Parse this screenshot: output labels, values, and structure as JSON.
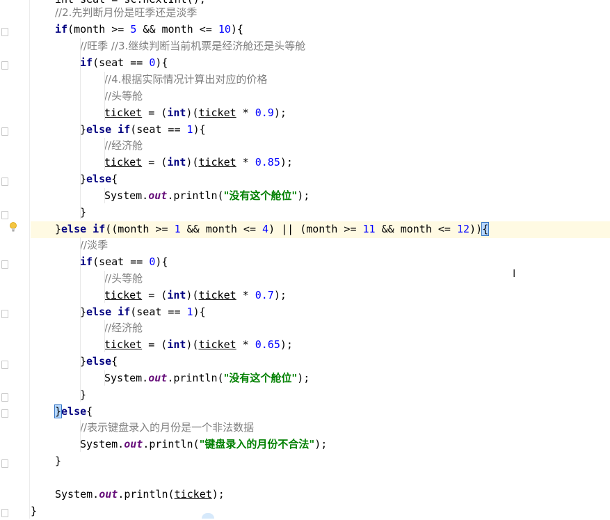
{
  "editor": {
    "lines": [
      {
        "id": "l0",
        "parts": [
          {
            "t": "int seat = sc.nextInt();",
            "k": "partial"
          }
        ]
      },
      {
        "id": "l1",
        "parts": [
          {
            "t": "//2.先判断月份是旺季还是淡季",
            "k": "comment"
          }
        ]
      },
      {
        "id": "l2",
        "parts": [
          {
            "t": "if",
            "k": "kw"
          },
          {
            "t": "(month >= ",
            "k": "var"
          },
          {
            "t": "5",
            "k": "num"
          },
          {
            "t": " && month <= ",
            "k": "var"
          },
          {
            "t": "10",
            "k": "num"
          },
          {
            "t": "){",
            "k": "var"
          }
        ]
      },
      {
        "id": "l3",
        "parts": [
          {
            "t": "//旺季 //3.继续判断当前机票是经济舱还是头等舱",
            "k": "comment"
          }
        ]
      },
      {
        "id": "l4",
        "parts": [
          {
            "t": "if",
            "k": "kw"
          },
          {
            "t": "(seat == ",
            "k": "var"
          },
          {
            "t": "0",
            "k": "num"
          },
          {
            "t": "){",
            "k": "var"
          }
        ]
      },
      {
        "id": "l5",
        "parts": [
          {
            "t": "//4.根据实际情况计算出对应的价格",
            "k": "comment"
          }
        ]
      },
      {
        "id": "l6",
        "parts": [
          {
            "t": "//头等舱",
            "k": "comment"
          }
        ]
      },
      {
        "id": "l7",
        "parts": [
          {
            "t": "ticket",
            "k": "ul"
          },
          {
            "t": " = (",
            "k": "var"
          },
          {
            "t": "int",
            "k": "kw"
          },
          {
            "t": ")(",
            "k": "var"
          },
          {
            "t": "ticket",
            "k": "ul"
          },
          {
            "t": " * ",
            "k": "var"
          },
          {
            "t": "0.9",
            "k": "num"
          },
          {
            "t": ");",
            "k": "var"
          }
        ]
      },
      {
        "id": "l8",
        "parts": [
          {
            "t": "}",
            "k": "var"
          },
          {
            "t": "else if",
            "k": "kw"
          },
          {
            "t": "(seat == ",
            "k": "var"
          },
          {
            "t": "1",
            "k": "num"
          },
          {
            "t": "){",
            "k": "var"
          }
        ]
      },
      {
        "id": "l9",
        "parts": [
          {
            "t": "//经济舱",
            "k": "comment"
          }
        ]
      },
      {
        "id": "l10",
        "parts": [
          {
            "t": "ticket",
            "k": "ul"
          },
          {
            "t": " = (",
            "k": "var"
          },
          {
            "t": "int",
            "k": "kw"
          },
          {
            "t": ")(",
            "k": "var"
          },
          {
            "t": "ticket",
            "k": "ul"
          },
          {
            "t": " * ",
            "k": "var"
          },
          {
            "t": "0.85",
            "k": "num"
          },
          {
            "t": ");",
            "k": "var"
          }
        ]
      },
      {
        "id": "l11",
        "parts": [
          {
            "t": "}",
            "k": "var"
          },
          {
            "t": "else",
            "k": "kw"
          },
          {
            "t": "{",
            "k": "var"
          }
        ]
      },
      {
        "id": "l12",
        "parts": [
          {
            "t": "System.",
            "k": "var"
          },
          {
            "t": "out",
            "k": "static"
          },
          {
            "t": ".println(",
            "k": "var"
          },
          {
            "t": "\"没有这个舱位\"",
            "k": "str"
          },
          {
            "t": ");",
            "k": "var"
          }
        ]
      },
      {
        "id": "l13",
        "parts": [
          {
            "t": "}",
            "k": "var"
          }
        ]
      },
      {
        "id": "l14",
        "parts": [
          {
            "t": "}",
            "k": "var"
          },
          {
            "t": "else if",
            "k": "kw"
          },
          {
            "t": "((month >= ",
            "k": "var"
          },
          {
            "t": "1",
            "k": "num"
          },
          {
            "t": " && month <= ",
            "k": "var"
          },
          {
            "t": "4",
            "k": "num"
          },
          {
            "t": ") || (month >= ",
            "k": "var"
          },
          {
            "t": "11",
            "k": "num"
          },
          {
            "t": " && month <= ",
            "k": "var"
          },
          {
            "t": "12",
            "k": "num"
          },
          {
            "t": "))",
            "k": "var"
          },
          {
            "t": "{",
            "k": "brace"
          }
        ]
      },
      {
        "id": "l15",
        "parts": [
          {
            "t": "//淡季",
            "k": "comment"
          }
        ]
      },
      {
        "id": "l16",
        "parts": [
          {
            "t": "if",
            "k": "kw"
          },
          {
            "t": "(seat == ",
            "k": "var"
          },
          {
            "t": "0",
            "k": "num"
          },
          {
            "t": "){",
            "k": "var"
          }
        ]
      },
      {
        "id": "l17",
        "parts": [
          {
            "t": "//头等舱",
            "k": "comment"
          }
        ]
      },
      {
        "id": "l18",
        "parts": [
          {
            "t": "ticket",
            "k": "ul"
          },
          {
            "t": " = (",
            "k": "var"
          },
          {
            "t": "int",
            "k": "kw"
          },
          {
            "t": ")(",
            "k": "var"
          },
          {
            "t": "ticket",
            "k": "ul"
          },
          {
            "t": " * ",
            "k": "var"
          },
          {
            "t": "0.7",
            "k": "num"
          },
          {
            "t": ");",
            "k": "var"
          }
        ]
      },
      {
        "id": "l19",
        "parts": [
          {
            "t": "}",
            "k": "var"
          },
          {
            "t": "else if",
            "k": "kw"
          },
          {
            "t": "(seat == ",
            "k": "var"
          },
          {
            "t": "1",
            "k": "num"
          },
          {
            "t": "){",
            "k": "var"
          }
        ]
      },
      {
        "id": "l20",
        "parts": [
          {
            "t": "//经济舱",
            "k": "comment"
          }
        ]
      },
      {
        "id": "l21",
        "parts": [
          {
            "t": "ticket",
            "k": "ul"
          },
          {
            "t": " = (",
            "k": "var"
          },
          {
            "t": "int",
            "k": "kw"
          },
          {
            "t": ")(",
            "k": "var"
          },
          {
            "t": "ticket",
            "k": "ul"
          },
          {
            "t": " * ",
            "k": "var"
          },
          {
            "t": "0.65",
            "k": "num"
          },
          {
            "t": ");",
            "k": "var"
          }
        ]
      },
      {
        "id": "l22",
        "parts": [
          {
            "t": "}",
            "k": "var"
          },
          {
            "t": "else",
            "k": "kw"
          },
          {
            "t": "{",
            "k": "var"
          }
        ]
      },
      {
        "id": "l23",
        "parts": [
          {
            "t": "System.",
            "k": "var"
          },
          {
            "t": "out",
            "k": "static"
          },
          {
            "t": ".println(",
            "k": "var"
          },
          {
            "t": "\"没有这个舱位\"",
            "k": "str"
          },
          {
            "t": ");",
            "k": "var"
          }
        ]
      },
      {
        "id": "l24",
        "parts": [
          {
            "t": "}",
            "k": "var"
          }
        ]
      },
      {
        "id": "l25",
        "parts": [
          {
            "t": "}",
            "k": "brace"
          },
          {
            "t": "else",
            "k": "kw"
          },
          {
            "t": "{",
            "k": "var"
          }
        ]
      },
      {
        "id": "l26",
        "parts": [
          {
            "t": "//表示键盘录入的月份是一个非法数据",
            "k": "comment"
          }
        ]
      },
      {
        "id": "l27",
        "parts": [
          {
            "t": "System.",
            "k": "var"
          },
          {
            "t": "out",
            "k": "static"
          },
          {
            "t": ".println(",
            "k": "var"
          },
          {
            "t": "\"键盘录入的月份不合法\"",
            "k": "str"
          },
          {
            "t": ");",
            "k": "var"
          }
        ]
      },
      {
        "id": "l28",
        "parts": [
          {
            "t": "}",
            "k": "var"
          }
        ]
      },
      {
        "id": "l29",
        "parts": []
      },
      {
        "id": "l30",
        "parts": [
          {
            "t": "System.",
            "k": "var"
          },
          {
            "t": "out",
            "k": "static"
          },
          {
            "t": ".println(",
            "k": "var"
          },
          {
            "t": "ticket",
            "k": "ul"
          },
          {
            "t": ");",
            "k": "var"
          }
        ]
      },
      {
        "id": "l31",
        "parts": [
          {
            "t": "}",
            "k": "var"
          }
        ]
      }
    ],
    "colors": {
      "comment": "#808080",
      "keyword": "#000080",
      "number": "#0000ff",
      "string": "#008000",
      "static_field": "#660e7a",
      "current_line": "#fffae3",
      "brace_match": "#b4d7ff"
    },
    "icons": {
      "intention": "lightbulb-icon",
      "fold": "fold-marker-icon",
      "cursor": "text-cursor-icon"
    }
  }
}
